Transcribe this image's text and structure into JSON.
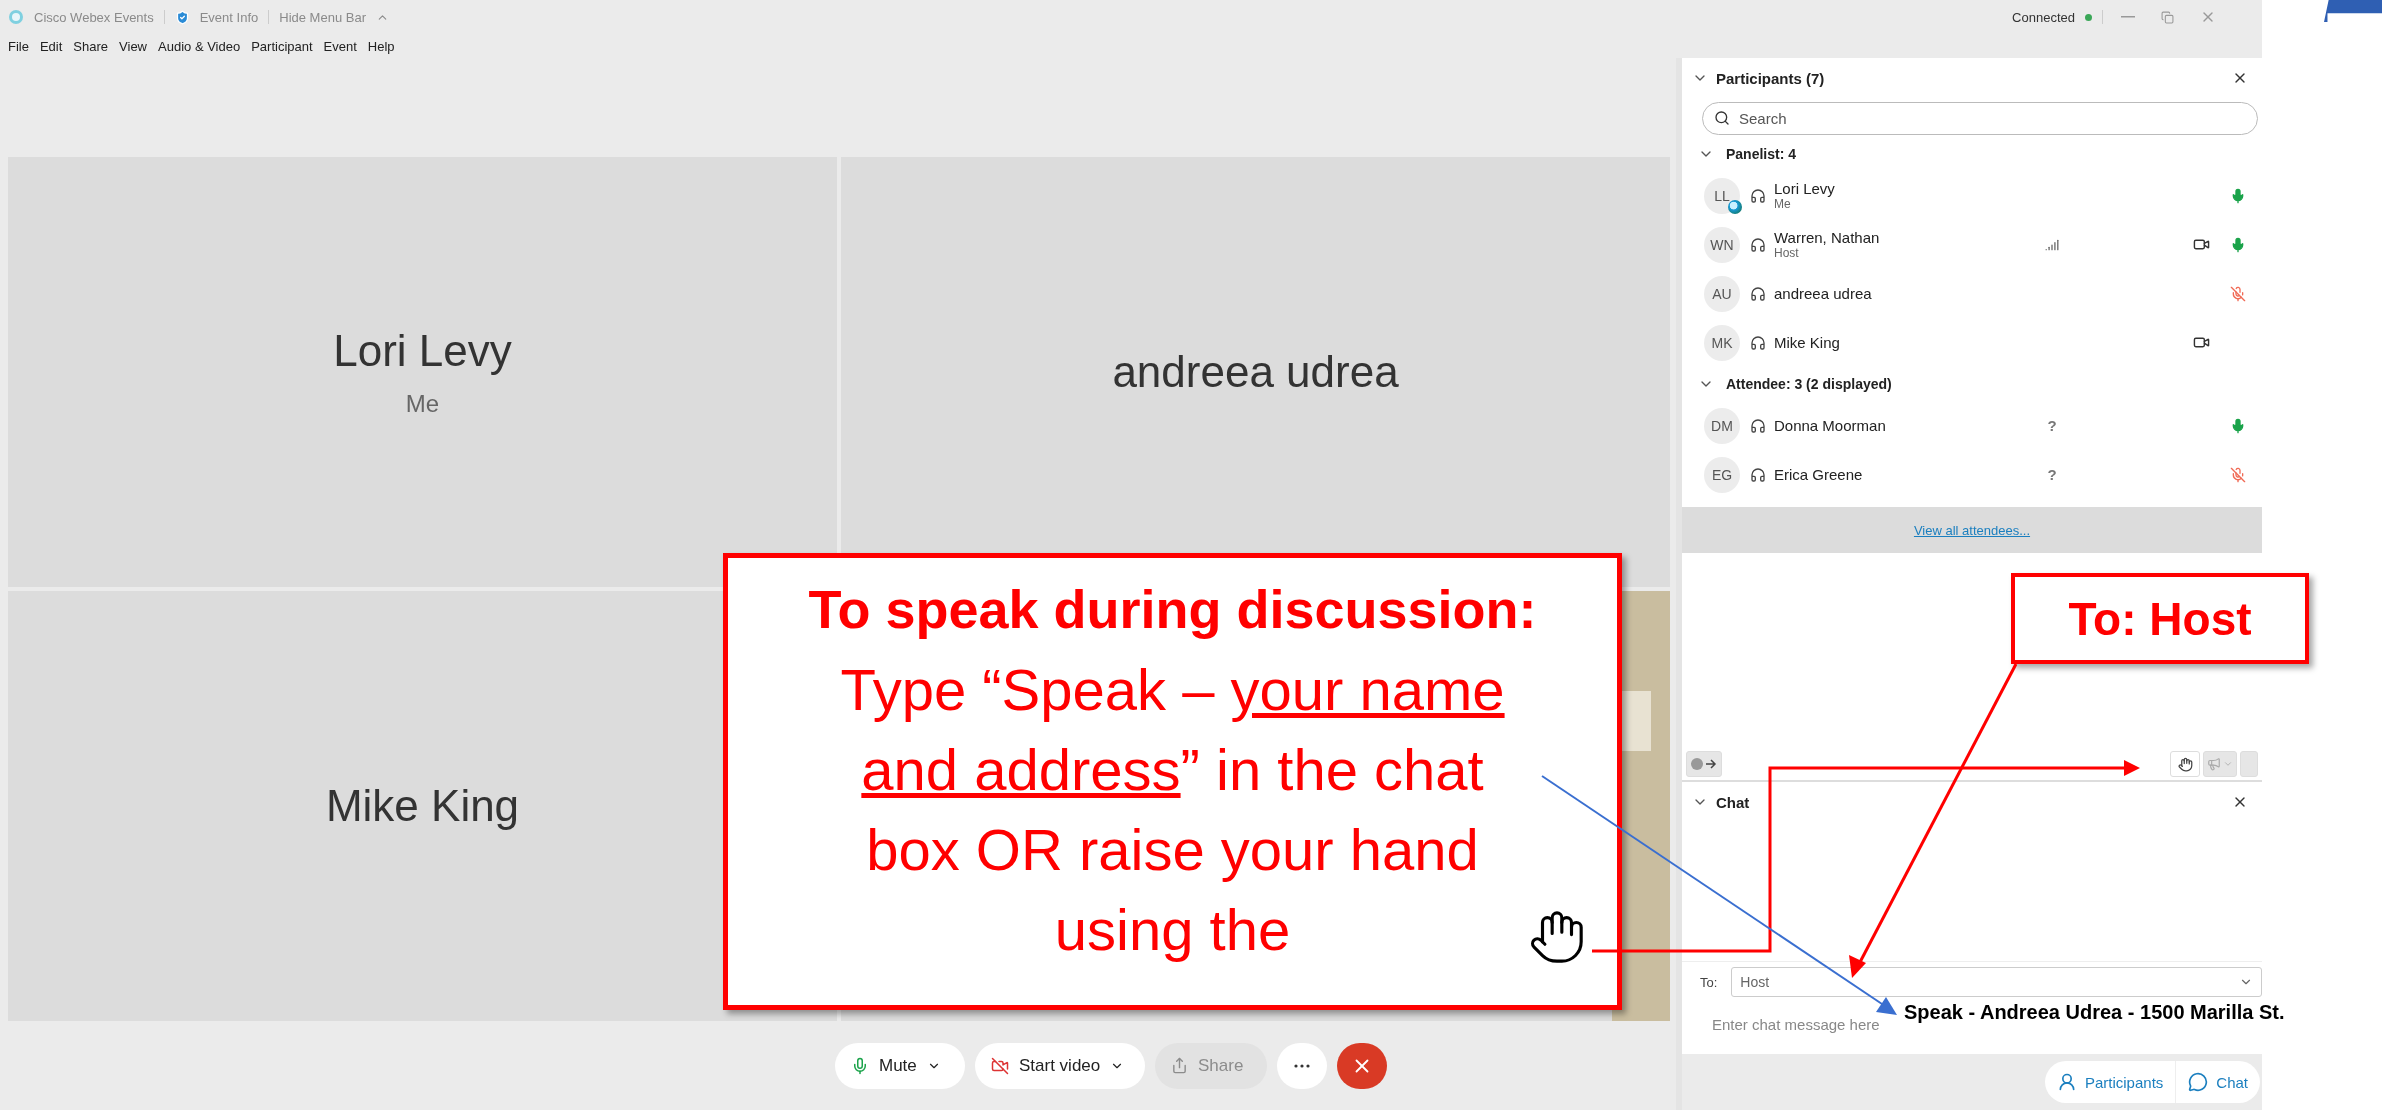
{
  "title_bar": {
    "app_name": "Cisco Webex Events",
    "event_info": "Event Info",
    "hide_menu": "Hide Menu Bar",
    "status": "Connected",
    "connected": true
  },
  "menu": [
    "File",
    "Edit",
    "Share",
    "View",
    "Audio & Video",
    "Participant",
    "Event",
    "Help"
  ],
  "tiles": [
    {
      "kind": "name",
      "name": "Lori Levy",
      "subtitle": "Me"
    },
    {
      "kind": "name",
      "name": "andreea udrea"
    },
    {
      "kind": "name",
      "name": "Mike King"
    },
    {
      "kind": "picture"
    }
  ],
  "controls": [
    {
      "kind": "mic",
      "label": "Mute",
      "dropdown": true
    },
    {
      "kind": "video",
      "label": "Start video",
      "dropdown": true
    },
    {
      "kind": "share",
      "label": "Share",
      "disabled": true
    },
    {
      "kind": "more"
    },
    {
      "kind": "end"
    }
  ],
  "participants_panel": {
    "title": "Participants (7)",
    "search": {
      "placeholder": "Search"
    },
    "groups": [
      {
        "title": "Panelist: 4",
        "expanded": true,
        "participants": [
          {
            "initials": "LL",
            "name": "Lori Levy",
            "role": "Me",
            "badge": true,
            "muted": false
          },
          {
            "initials": "WN",
            "name": "Warren, Nathan",
            "role": "Host",
            "signal": true,
            "muted": false,
            "video": true
          },
          {
            "initials": "AU",
            "name": "andreea udrea",
            "muted": true
          },
          {
            "initials": "MK",
            "name": "Mike King",
            "video": true
          }
        ]
      },
      {
        "title": "Attendee: 3 (2 displayed)",
        "expanded": true,
        "participants": [
          {
            "initials": "DM",
            "name": "Donna Moorman",
            "note": "?",
            "muted": false
          },
          {
            "initials": "EG",
            "name": "Erica Greene",
            "note": "?",
            "muted": true
          }
        ]
      }
    ],
    "view_all": "View all attendees..."
  },
  "chat_panel": {
    "title": "Chat",
    "expanded": true,
    "to_label": "To:",
    "to_value": "Host",
    "placeholder": "Enter chat message here"
  },
  "panel_tabs": [
    {
      "kind": "participants",
      "label": "Participants"
    },
    {
      "kind": "chat",
      "label": "Chat"
    }
  ],
  "callouts": {
    "main": {
      "heading": "To speak during discussion:",
      "body": [
        {
          "text": "Type “Speak – ",
          "underlined": false
        },
        {
          "text": "your name and address",
          "underlined": true
        },
        {
          "text": "” in the chat box OR raise your hand using the",
          "underlined": false
        }
      ]
    },
    "to_host": "To: Host",
    "example_message": "Speak - Andreea Udrea - 1500 Marilla St."
  }
}
